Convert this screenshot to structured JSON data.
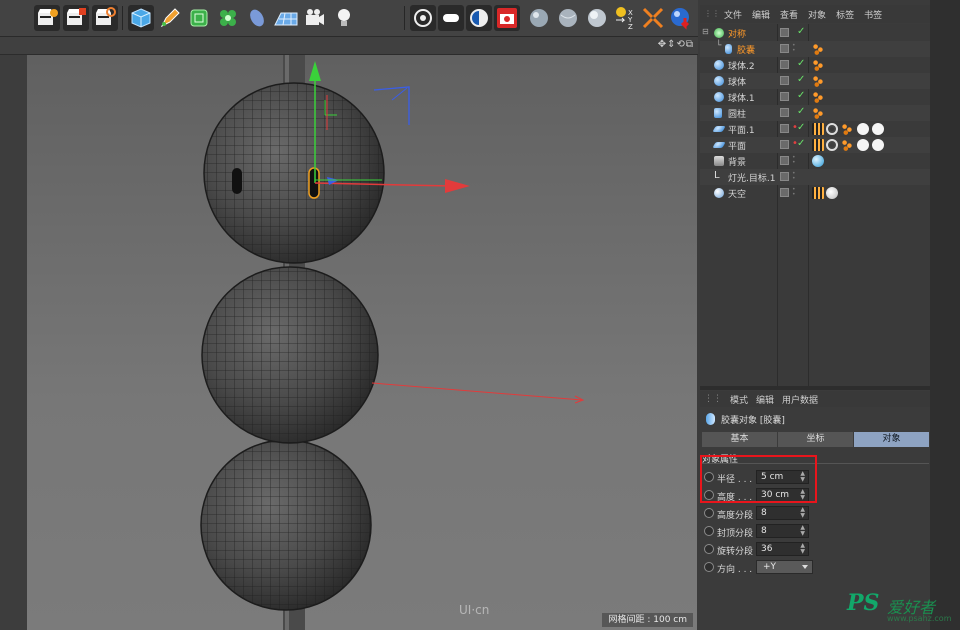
{
  "object_manager": {
    "menu": [
      "文件",
      "编辑",
      "查看",
      "对象",
      "标签",
      "书签"
    ],
    "objects": [
      {
        "name": "对称",
        "selected_parent": true
      },
      {
        "name": "胶囊",
        "selected": true
      },
      {
        "name": "球体.2"
      },
      {
        "name": "球体"
      },
      {
        "name": "球体.1"
      },
      {
        "name": "圆柱"
      },
      {
        "name": "平面.1"
      },
      {
        "name": "平面"
      },
      {
        "name": "背景"
      },
      {
        "name": "灯光.目标.1"
      },
      {
        "name": "天空"
      }
    ]
  },
  "attribute_manager": {
    "menu": [
      "模式",
      "编辑",
      "用户数据"
    ],
    "title": "胶囊对象 [胶囊]",
    "tabs": [
      "基本",
      "坐标",
      "对象"
    ],
    "active_tab": "对象",
    "section": "对象属性",
    "params": [
      {
        "label": "半径 . . .",
        "value": "5 cm"
      },
      {
        "label": "高度 . . .",
        "value": "30 cm"
      },
      {
        "label": "高度分段",
        "value": "8"
      },
      {
        "label": "封顶分段",
        "value": "8"
      },
      {
        "label": "旋转分段",
        "value": "36"
      },
      {
        "label": "方向 . . .",
        "value": "+Y",
        "dropdown": true
      }
    ]
  },
  "viewport": {
    "nav_icons": "✥⇕⟲⧉",
    "grid_info": "网格间距 : 100 cm",
    "watermark": "UI·cn"
  },
  "logo": {
    "main": "PS",
    "sub": "爱好者",
    "url": "www.psahz.com"
  },
  "colors": {
    "accent_tab": "#8ea3c2",
    "highlight_box": "#e8151c",
    "selected_text": "#ff9a2a",
    "axis_x": "#e23b3b",
    "axis_y": "#3ad13a",
    "axis_z": "#3a5ee8"
  }
}
